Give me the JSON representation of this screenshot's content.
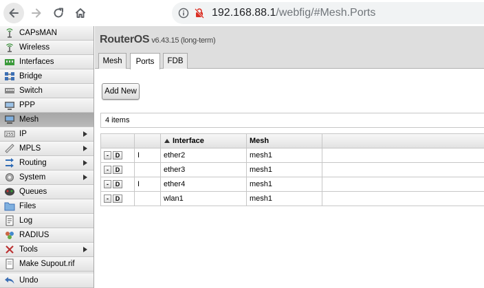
{
  "browser": {
    "url_host": "192.168.88.1",
    "url_path": "/webfig/#Mesh.Ports"
  },
  "sidebar": {
    "items": [
      {
        "label": "CAPsMAN",
        "icon": "capsman-icon",
        "arrow": false,
        "active": false
      },
      {
        "label": "Wireless",
        "icon": "wireless-icon",
        "arrow": false,
        "active": false
      },
      {
        "label": "Interfaces",
        "icon": "interfaces-icon",
        "arrow": false,
        "active": false
      },
      {
        "label": "Bridge",
        "icon": "bridge-icon",
        "arrow": false,
        "active": false
      },
      {
        "label": "Switch",
        "icon": "switch-icon",
        "arrow": false,
        "active": false
      },
      {
        "label": "PPP",
        "icon": "ppp-icon",
        "arrow": false,
        "active": false
      },
      {
        "label": "Mesh",
        "icon": "mesh-icon",
        "arrow": false,
        "active": true
      },
      {
        "label": "IP",
        "icon": "ip-icon",
        "arrow": true,
        "active": false
      },
      {
        "label": "MPLS",
        "icon": "mpls-icon",
        "arrow": true,
        "active": false
      },
      {
        "label": "Routing",
        "icon": "routing-icon",
        "arrow": true,
        "active": false
      },
      {
        "label": "System",
        "icon": "system-icon",
        "arrow": true,
        "active": false
      },
      {
        "label": "Queues",
        "icon": "queues-icon",
        "arrow": false,
        "active": false
      },
      {
        "label": "Files",
        "icon": "files-icon",
        "arrow": false,
        "active": false
      },
      {
        "label": "Log",
        "icon": "log-icon",
        "arrow": false,
        "active": false
      },
      {
        "label": "RADIUS",
        "icon": "radius-icon",
        "arrow": false,
        "active": false
      },
      {
        "label": "Tools",
        "icon": "tools-icon",
        "arrow": true,
        "active": false
      },
      {
        "label": "Make Supout.rif",
        "icon": "supout-icon",
        "arrow": false,
        "active": false
      },
      {
        "label": "Undo",
        "icon": "undo-icon",
        "arrow": false,
        "active": false
      }
    ]
  },
  "header": {
    "product_name": "RouterOS",
    "product_version": "v6.43.15 (long-term)"
  },
  "tabs": [
    {
      "label": "Mesh",
      "active": false
    },
    {
      "label": "Ports",
      "active": true
    },
    {
      "label": "FDB",
      "active": false
    }
  ],
  "toolbar": {
    "add_new_label": "Add New"
  },
  "list": {
    "count_text": "4 items",
    "columns": {
      "flags": "",
      "interface": "Interface",
      "mesh": "Mesh"
    },
    "row_buttons": {
      "remove": "-",
      "disable": "D"
    },
    "rows": [
      {
        "flag": "I",
        "interface": "ether2",
        "mesh": "mesh1"
      },
      {
        "flag": "",
        "interface": "ether3",
        "mesh": "mesh1"
      },
      {
        "flag": "I",
        "interface": "ether4",
        "mesh": "mesh1"
      },
      {
        "flag": "",
        "interface": "wlan1",
        "mesh": "mesh1"
      }
    ]
  },
  "colors": {
    "sidebar_active": "#a6a6a6",
    "header_band": "#dedede"
  }
}
